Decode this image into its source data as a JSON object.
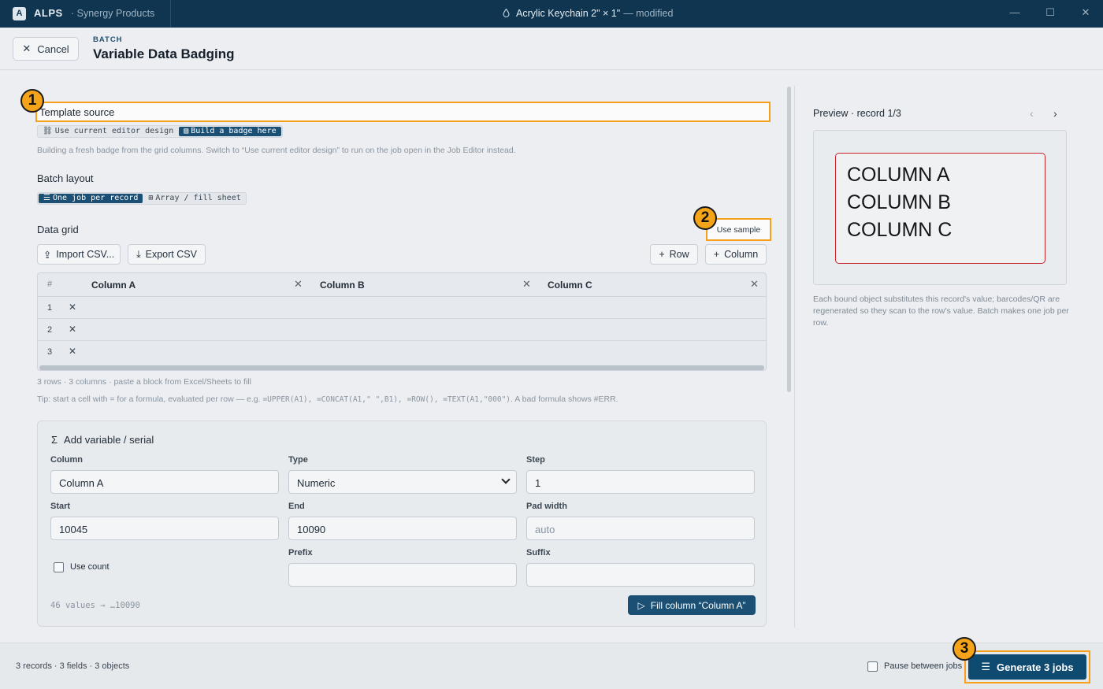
{
  "titlebar": {
    "logo": "A",
    "app_name": "ALPS",
    "workspace": "· Synergy Products",
    "document": "Acrylic Keychain 2\" × 1\"",
    "modified": "— modified"
  },
  "header": {
    "cancel_label": "Cancel",
    "kicker": "BATCH",
    "title": "Variable Data Badging"
  },
  "template_source": {
    "label": "Template source",
    "options": [
      "Use current editor design",
      "Build a badge here"
    ],
    "active_option": "Build a badge here",
    "hint": "Building a fresh badge from the grid columns. Switch to “Use current editor design” to run on the job open in the Job Editor instead."
  },
  "batch_layout": {
    "label": "Batch layout",
    "options": [
      "One job per record",
      "Array / fill sheet"
    ],
    "active_option": "One job per record"
  },
  "data_grid": {
    "label": "Data grid",
    "use_sample_label": "Use sample",
    "import_label": "Import CSV...",
    "export_label": "Export CSV",
    "add_row_label": "Row",
    "add_column_label": "Column",
    "hash_header": "#",
    "columns": [
      "Column A",
      "Column B",
      "Column C"
    ],
    "rows": [
      {
        "num": "1"
      },
      {
        "num": "2"
      },
      {
        "num": "3"
      }
    ],
    "summary": "3 rows · 3 columns · paste a block from Excel/Sheets to fill",
    "tip_prefix": "Tip: start a cell with = for a formula, evaluated per row — e.g. ",
    "tip_code": "=UPPER(A1), =CONCAT(A1,\" \",B1), =ROW(), =TEXT(A1,\"000\")",
    "tip_suffix": ". A bad formula shows #ERR."
  },
  "variable": {
    "title": "Add variable / serial",
    "column_label": "Column",
    "column_value": "Column A",
    "type_label": "Type",
    "type_value": "Numeric",
    "step_label": "Step",
    "step_value": "1",
    "start_label": "Start",
    "start_value": "10045",
    "end_label": "End",
    "end_value": "10090",
    "pad_label": "Pad width",
    "pad_placeholder": "auto",
    "prefix_label": "Prefix",
    "suffix_label": "Suffix",
    "use_count_label": "Use count",
    "use_count_checked": false,
    "values_summary": "46 values → …10090",
    "fill_label": "Fill column “Column A”"
  },
  "preview": {
    "title": "Preview · record 1/3",
    "badge_lines": [
      "COLUMN A",
      "COLUMN B",
      "COLUMN C"
    ],
    "note": "Each bound object substitutes this record's value; barcodes/QR are regenerated so they scan to the row's value. Batch makes one job per row."
  },
  "footer": {
    "summary": "3 records · 3 fields · 3 objects",
    "pause_label": "Pause between jobs",
    "pause_checked": false,
    "generate_label": "Generate 3 jobs"
  },
  "markers": [
    "1",
    "2",
    "3"
  ],
  "colors": {
    "accent": "#1b4f73",
    "highlight": "#f59f1a",
    "badge_border": "#c4252b"
  }
}
